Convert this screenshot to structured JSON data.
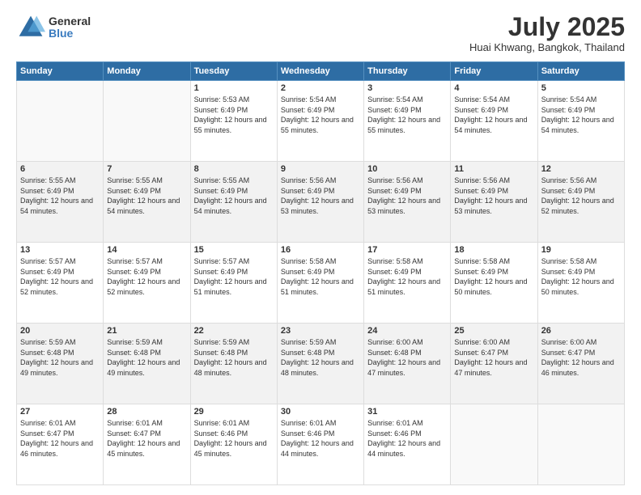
{
  "logo": {
    "general": "General",
    "blue": "Blue"
  },
  "title": "July 2025",
  "subtitle": "Huai Khwang, Bangkok, Thailand",
  "days_of_week": [
    "Sunday",
    "Monday",
    "Tuesday",
    "Wednesday",
    "Thursday",
    "Friday",
    "Saturday"
  ],
  "weeks": [
    [
      {
        "day": "",
        "info": ""
      },
      {
        "day": "",
        "info": ""
      },
      {
        "day": "1",
        "info": "Sunrise: 5:53 AM\nSunset: 6:49 PM\nDaylight: 12 hours and 55 minutes."
      },
      {
        "day": "2",
        "info": "Sunrise: 5:54 AM\nSunset: 6:49 PM\nDaylight: 12 hours and 55 minutes."
      },
      {
        "day": "3",
        "info": "Sunrise: 5:54 AM\nSunset: 6:49 PM\nDaylight: 12 hours and 55 minutes."
      },
      {
        "day": "4",
        "info": "Sunrise: 5:54 AM\nSunset: 6:49 PM\nDaylight: 12 hours and 54 minutes."
      },
      {
        "day": "5",
        "info": "Sunrise: 5:54 AM\nSunset: 6:49 PM\nDaylight: 12 hours and 54 minutes."
      }
    ],
    [
      {
        "day": "6",
        "info": "Sunrise: 5:55 AM\nSunset: 6:49 PM\nDaylight: 12 hours and 54 minutes."
      },
      {
        "day": "7",
        "info": "Sunrise: 5:55 AM\nSunset: 6:49 PM\nDaylight: 12 hours and 54 minutes."
      },
      {
        "day": "8",
        "info": "Sunrise: 5:55 AM\nSunset: 6:49 PM\nDaylight: 12 hours and 54 minutes."
      },
      {
        "day": "9",
        "info": "Sunrise: 5:56 AM\nSunset: 6:49 PM\nDaylight: 12 hours and 53 minutes."
      },
      {
        "day": "10",
        "info": "Sunrise: 5:56 AM\nSunset: 6:49 PM\nDaylight: 12 hours and 53 minutes."
      },
      {
        "day": "11",
        "info": "Sunrise: 5:56 AM\nSunset: 6:49 PM\nDaylight: 12 hours and 53 minutes."
      },
      {
        "day": "12",
        "info": "Sunrise: 5:56 AM\nSunset: 6:49 PM\nDaylight: 12 hours and 52 minutes."
      }
    ],
    [
      {
        "day": "13",
        "info": "Sunrise: 5:57 AM\nSunset: 6:49 PM\nDaylight: 12 hours and 52 minutes."
      },
      {
        "day": "14",
        "info": "Sunrise: 5:57 AM\nSunset: 6:49 PM\nDaylight: 12 hours and 52 minutes."
      },
      {
        "day": "15",
        "info": "Sunrise: 5:57 AM\nSunset: 6:49 PM\nDaylight: 12 hours and 51 minutes."
      },
      {
        "day": "16",
        "info": "Sunrise: 5:58 AM\nSunset: 6:49 PM\nDaylight: 12 hours and 51 minutes."
      },
      {
        "day": "17",
        "info": "Sunrise: 5:58 AM\nSunset: 6:49 PM\nDaylight: 12 hours and 51 minutes."
      },
      {
        "day": "18",
        "info": "Sunrise: 5:58 AM\nSunset: 6:49 PM\nDaylight: 12 hours and 50 minutes."
      },
      {
        "day": "19",
        "info": "Sunrise: 5:58 AM\nSunset: 6:49 PM\nDaylight: 12 hours and 50 minutes."
      }
    ],
    [
      {
        "day": "20",
        "info": "Sunrise: 5:59 AM\nSunset: 6:48 PM\nDaylight: 12 hours and 49 minutes."
      },
      {
        "day": "21",
        "info": "Sunrise: 5:59 AM\nSunset: 6:48 PM\nDaylight: 12 hours and 49 minutes."
      },
      {
        "day": "22",
        "info": "Sunrise: 5:59 AM\nSunset: 6:48 PM\nDaylight: 12 hours and 48 minutes."
      },
      {
        "day": "23",
        "info": "Sunrise: 5:59 AM\nSunset: 6:48 PM\nDaylight: 12 hours and 48 minutes."
      },
      {
        "day": "24",
        "info": "Sunrise: 6:00 AM\nSunset: 6:48 PM\nDaylight: 12 hours and 47 minutes."
      },
      {
        "day": "25",
        "info": "Sunrise: 6:00 AM\nSunset: 6:47 PM\nDaylight: 12 hours and 47 minutes."
      },
      {
        "day": "26",
        "info": "Sunrise: 6:00 AM\nSunset: 6:47 PM\nDaylight: 12 hours and 46 minutes."
      }
    ],
    [
      {
        "day": "27",
        "info": "Sunrise: 6:01 AM\nSunset: 6:47 PM\nDaylight: 12 hours and 46 minutes."
      },
      {
        "day": "28",
        "info": "Sunrise: 6:01 AM\nSunset: 6:47 PM\nDaylight: 12 hours and 45 minutes."
      },
      {
        "day": "29",
        "info": "Sunrise: 6:01 AM\nSunset: 6:46 PM\nDaylight: 12 hours and 45 minutes."
      },
      {
        "day": "30",
        "info": "Sunrise: 6:01 AM\nSunset: 6:46 PM\nDaylight: 12 hours and 44 minutes."
      },
      {
        "day": "31",
        "info": "Sunrise: 6:01 AM\nSunset: 6:46 PM\nDaylight: 12 hours and 44 minutes."
      },
      {
        "day": "",
        "info": ""
      },
      {
        "day": "",
        "info": ""
      }
    ]
  ]
}
